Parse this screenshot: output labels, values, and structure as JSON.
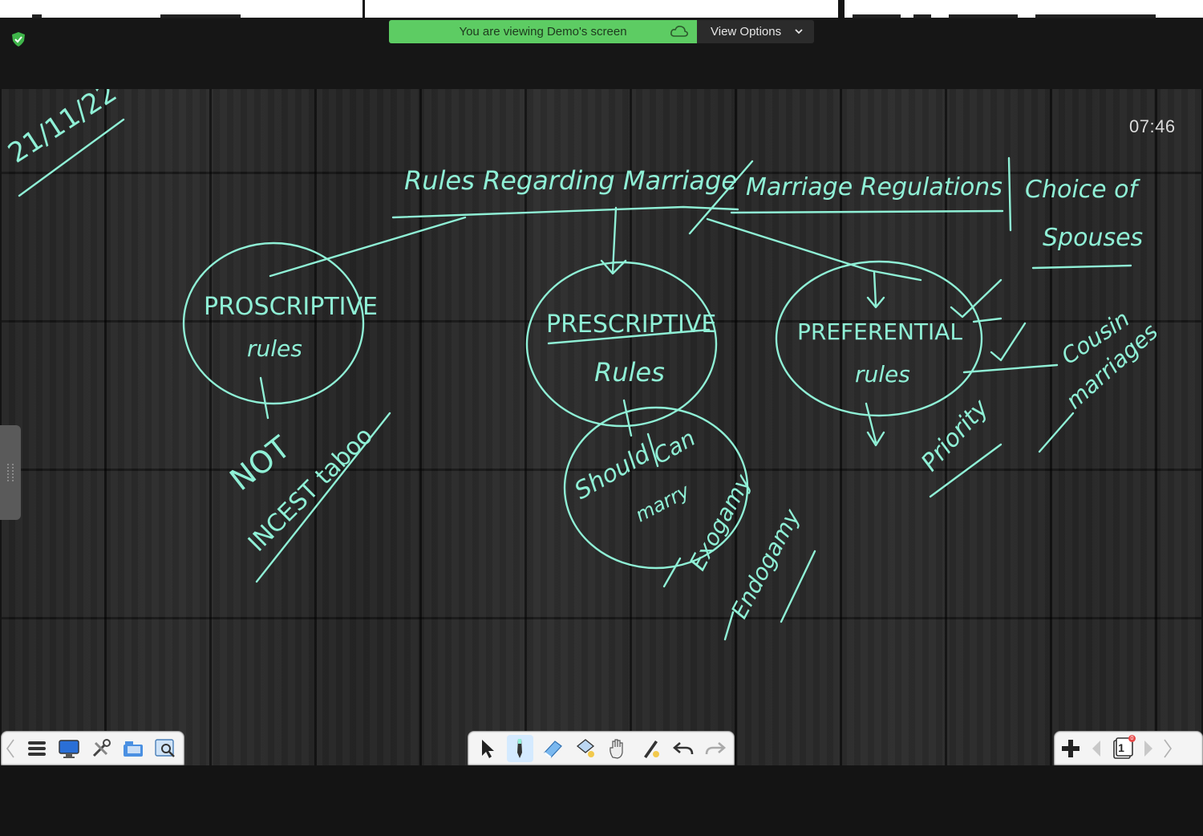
{
  "banner": {
    "viewing_text": "You are viewing Demo's screen",
    "view_options_label": "View Options",
    "accent_color": "#5dcc63"
  },
  "timer": "07:46",
  "whiteboard": {
    "ink_color": "#8ff0d6",
    "date": "21/11/22",
    "title_1": "Rules Regarding Marriage",
    "title_2": "Marriage Regulations",
    "title_3a": "Choice of",
    "title_3b": "Spouses",
    "node_1a": "PROSCRIPTIVE",
    "node_1b": "rules",
    "node_2a": "PRESCRIPTIVE",
    "node_2b": "Rules",
    "node_3a": "PREFERENTIAL",
    "node_3b": "rules",
    "note_not": "NOT",
    "note_incest": "INCEST taboo",
    "note_should": "Should",
    "note_can": "Can",
    "note_marry": "marry",
    "note_exogamy": "Exogamy",
    "note_endogamy": "Endogamy",
    "note_priority": "Priority",
    "note_cousin": "Cousin",
    "note_marriages": "marriages"
  },
  "toolbar_left": {
    "icons": [
      "menu-icon",
      "display-icon",
      "tools-icon",
      "folder-icon",
      "image-search-icon"
    ]
  },
  "toolbar_mid": {
    "icons": [
      "select-arrow-icon",
      "pen-icon",
      "eraser-icon",
      "fill-icon",
      "hand-icon",
      "magic-pen-icon",
      "undo-icon",
      "redo-icon"
    ]
  },
  "toolbar_right": {
    "page_number": "1",
    "page_badge": "0",
    "icons": [
      "add-page-icon",
      "prev-page-icon",
      "page-icon",
      "next-page-icon"
    ]
  }
}
